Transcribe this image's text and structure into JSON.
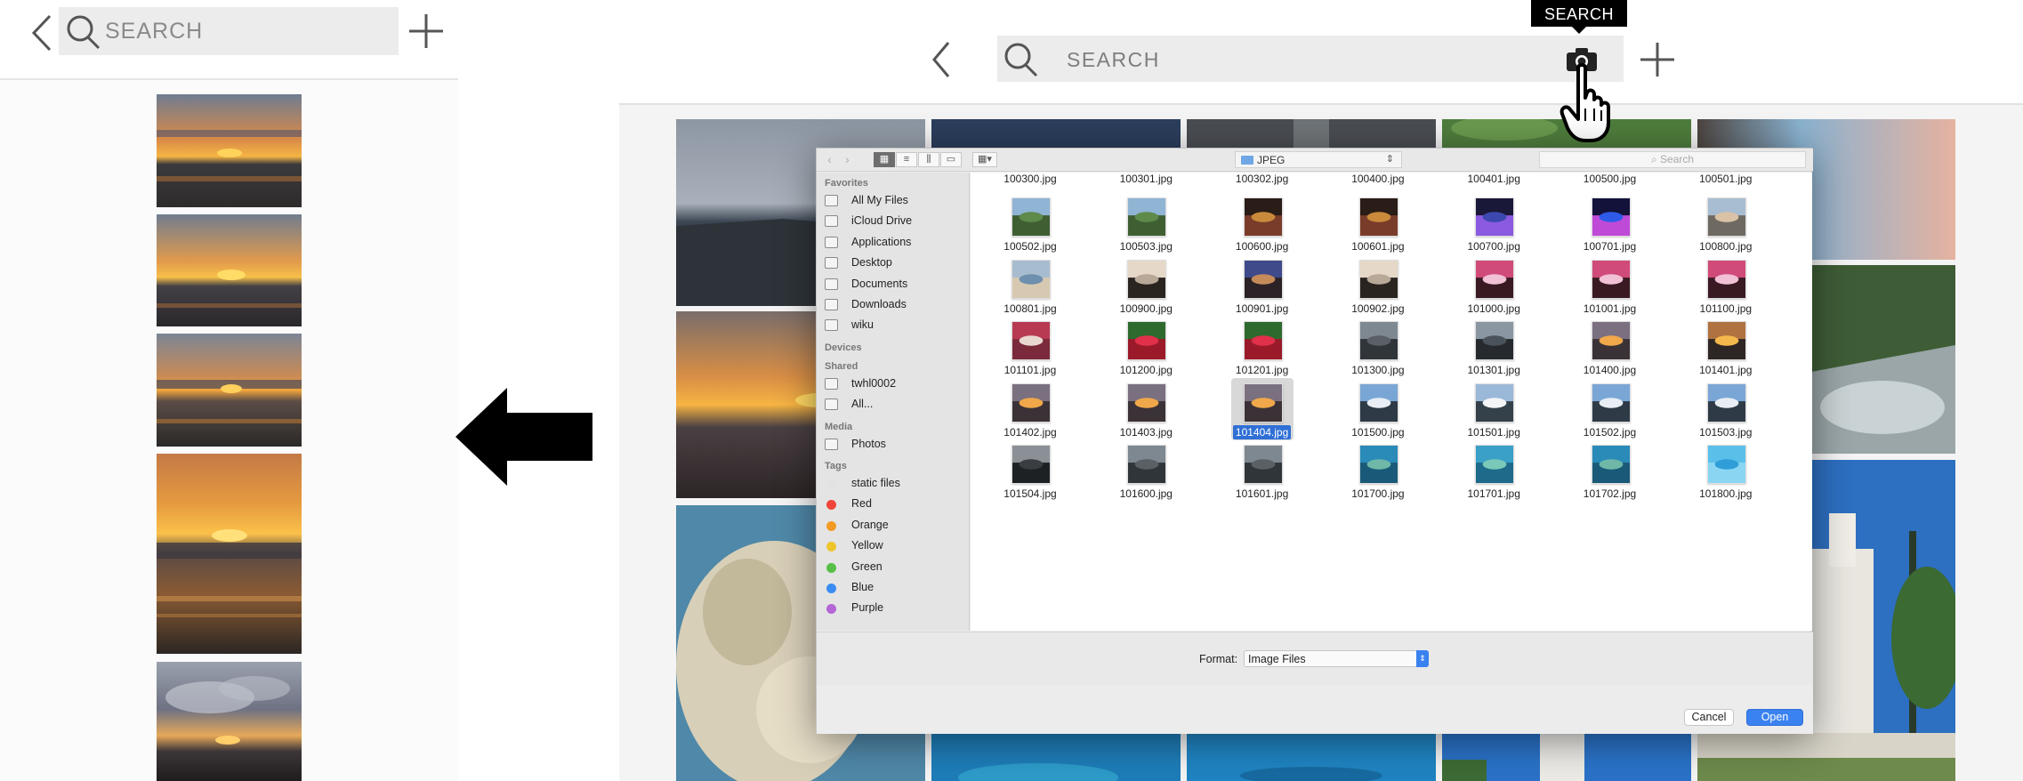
{
  "left": {
    "search_placeholder": "SEARCH",
    "thumbnails": [
      "sunset-1",
      "sunset-2",
      "sunset-3",
      "sunset-4",
      "cloudy-sunset"
    ]
  },
  "right": {
    "search_placeholder": "SEARCH",
    "tooltip": "SEARCH",
    "background_tiles": [
      "rocky-shore",
      "night-ocean",
      "dark-cave",
      "green-hills",
      "rock-sky",
      "sunset-shore",
      "forest-river",
      "coral-reef",
      "church",
      "underwater-1",
      "underwater-2",
      "church-tower",
      "garden"
    ]
  },
  "dialog": {
    "folder": "JPEG",
    "search_placeholder": "Search",
    "sidebar": [
      {
        "type": "header",
        "label": "Favorites"
      },
      {
        "type": "item",
        "label": "All My Files",
        "icon": "all-files-icon"
      },
      {
        "type": "item",
        "label": "iCloud Drive",
        "icon": "cloud-icon"
      },
      {
        "type": "item",
        "label": "Applications",
        "icon": "applications-icon"
      },
      {
        "type": "item",
        "label": "Desktop",
        "icon": "desktop-icon"
      },
      {
        "type": "item",
        "label": "Documents",
        "icon": "documents-icon"
      },
      {
        "type": "item",
        "label": "Downloads",
        "icon": "downloads-icon"
      },
      {
        "type": "item",
        "label": "wiku",
        "icon": "home-icon"
      },
      {
        "type": "header",
        "label": "Devices"
      },
      {
        "type": "header",
        "label": "Shared"
      },
      {
        "type": "item",
        "label": "twhl0002",
        "icon": "computer-icon"
      },
      {
        "type": "item",
        "label": "All...",
        "icon": "network-icon"
      },
      {
        "type": "header",
        "label": "Media"
      },
      {
        "type": "item",
        "label": "Photos",
        "icon": "photos-icon"
      },
      {
        "type": "header",
        "label": "Tags"
      },
      {
        "type": "tag",
        "label": "static files",
        "color": "#e2e2e2"
      },
      {
        "type": "tag",
        "label": "Red",
        "color": "#f0453a"
      },
      {
        "type": "tag",
        "label": "Orange",
        "color": "#f39a25"
      },
      {
        "type": "tag",
        "label": "Yellow",
        "color": "#eec52d"
      },
      {
        "type": "tag",
        "label": "Green",
        "color": "#56bf45"
      },
      {
        "type": "tag",
        "label": "Blue",
        "color": "#3b8cf2"
      },
      {
        "type": "tag",
        "label": "Purple",
        "color": "#b565d6"
      }
    ],
    "top_row": [
      "100300.jpg",
      "100301.jpg",
      "100302.jpg",
      "100400.jpg",
      "100401.jpg",
      "100500.jpg",
      "100501.jpg"
    ],
    "rows": [
      [
        {
          "name": "100502.jpg",
          "thumb": "landscape-green"
        },
        {
          "name": "100503.jpg",
          "thumb": "landscape-green"
        },
        {
          "name": "100600.jpg",
          "thumb": "portrait-lights"
        },
        {
          "name": "100601.jpg",
          "thumb": "portrait-lights"
        },
        {
          "name": "100700.jpg",
          "thumb": "portrait-night"
        },
        {
          "name": "100701.jpg",
          "thumb": "landscape-night"
        },
        {
          "name": "100800.jpg",
          "thumb": "portrait-sky"
        }
      ],
      [
        {
          "name": "100801.jpg",
          "thumb": "portrait-sea"
        },
        {
          "name": "100900.jpg",
          "thumb": "portrait-silhouette"
        },
        {
          "name": "100901.jpg",
          "thumb": "portrait-dusk"
        },
        {
          "name": "100902.jpg",
          "thumb": "portrait-silhouette"
        },
        {
          "name": "101000.jpg",
          "thumb": "portrait-pink"
        },
        {
          "name": "101001.jpg",
          "thumb": "portrait-pink"
        },
        {
          "name": "101100.jpg",
          "thumb": "portrait-pink"
        }
      ],
      [
        {
          "name": "101101.jpg",
          "thumb": "landscape-food"
        },
        {
          "name": "101200.jpg",
          "thumb": "landscape-flower"
        },
        {
          "name": "101201.jpg",
          "thumb": "landscape-flower"
        },
        {
          "name": "101300.jpg",
          "thumb": "landscape-grey"
        },
        {
          "name": "101301.jpg",
          "thumb": "portrait-grey"
        },
        {
          "name": "101400.jpg",
          "thumb": "landscape-sunset"
        },
        {
          "name": "101401.jpg",
          "thumb": "portrait-sunset"
        }
      ],
      [
        {
          "name": "101402.jpg",
          "thumb": "landscape-sunset"
        },
        {
          "name": "101403.jpg",
          "thumb": "landscape-sunset"
        },
        {
          "name": "101404.jpg",
          "thumb": "landscape-sunset",
          "selected": true
        },
        {
          "name": "101500.jpg",
          "thumb": "landscape-mountain"
        },
        {
          "name": "101501.jpg",
          "thumb": "portrait-mountain"
        },
        {
          "name": "101502.jpg",
          "thumb": "landscape-mountain"
        },
        {
          "name": "101503.jpg",
          "thumb": "landscape-mountain"
        }
      ],
      [
        {
          "name": "101504.jpg",
          "thumb": "landscape-dark"
        },
        {
          "name": "101600.jpg",
          "thumb": "landscape-grey"
        },
        {
          "name": "101601.jpg",
          "thumb": "landscape-grey"
        },
        {
          "name": "101700.jpg",
          "thumb": "portrait-reef"
        },
        {
          "name": "101701.jpg",
          "thumb": "landscape-reef"
        },
        {
          "name": "101702.jpg",
          "thumb": "portrait-reef"
        },
        {
          "name": "101800.jpg",
          "thumb": "landscape-water"
        }
      ]
    ],
    "format_label": "Format:",
    "format_value": "Image Files",
    "cancel_label": "Cancel",
    "open_label": "Open"
  }
}
